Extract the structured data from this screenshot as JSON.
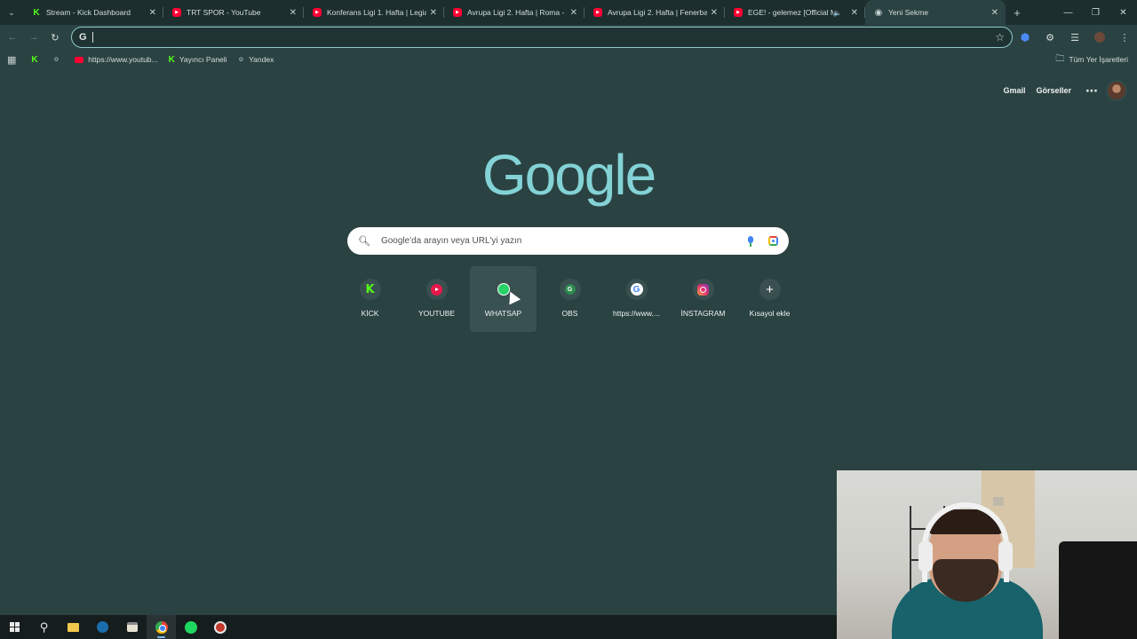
{
  "tabs": [
    {
      "title": "Stream - Kick Dashboard",
      "favicon": "kick-icon",
      "active": false
    },
    {
      "title": "TRT SPOR - YouTube",
      "favicon": "youtube-icon",
      "active": false
    },
    {
      "title": "Konferans Ligi 1. Hafta | Legia",
      "favicon": "youtube-icon",
      "active": false
    },
    {
      "title": "Avrupa Ligi 2. Hafta | Roma - L",
      "favicon": "youtube-icon",
      "active": false
    },
    {
      "title": "Avrupa Ligi 2. Hafta | Fenerbah",
      "favicon": "youtube-icon",
      "active": false
    },
    {
      "title": "EGE! - gelemez [Official Mu",
      "favicon": "youtube-icon",
      "active": false,
      "audio": true
    },
    {
      "title": "Yeni Sekme",
      "favicon": "chrome-icon",
      "active": true
    }
  ],
  "omnibox": {
    "value": "",
    "placeholder": ""
  },
  "bookmarks": [
    {
      "label": "",
      "icon": "kick-icon"
    },
    {
      "label": "",
      "icon": "globe-icon"
    },
    {
      "label": "https://www.youtub...",
      "icon": "youtube-icon"
    },
    {
      "label": "Yayıncı Paneli",
      "icon": "kick-icon"
    },
    {
      "label": "Yandex",
      "icon": "globe-icon"
    }
  ],
  "bookmarks_right": "Tüm Yer İşaretleri",
  "google_header": {
    "gmail": "Gmail",
    "images": "Görseller"
  },
  "logo": "Google",
  "search": {
    "placeholder": "Google'da arayın veya URL'yi yazın"
  },
  "shortcuts": [
    {
      "label": "KİCK",
      "icon": "kick-icon"
    },
    {
      "label": "YOUTUBE",
      "icon": "youtube-icon"
    },
    {
      "label": "WHATSAP",
      "icon": "whatsapp-icon"
    },
    {
      "label": "OBS",
      "icon": "obs-icon"
    },
    {
      "label": "https://www....",
      "icon": "google-icon"
    },
    {
      "label": "İNSTAGRAM",
      "icon": "instagram-icon"
    },
    {
      "label": "Kısayol ekle",
      "icon": "plus-icon"
    }
  ],
  "colors": {
    "background": "#2b4242",
    "logo": "#83d3d6",
    "accent": "#8fc9c9"
  }
}
